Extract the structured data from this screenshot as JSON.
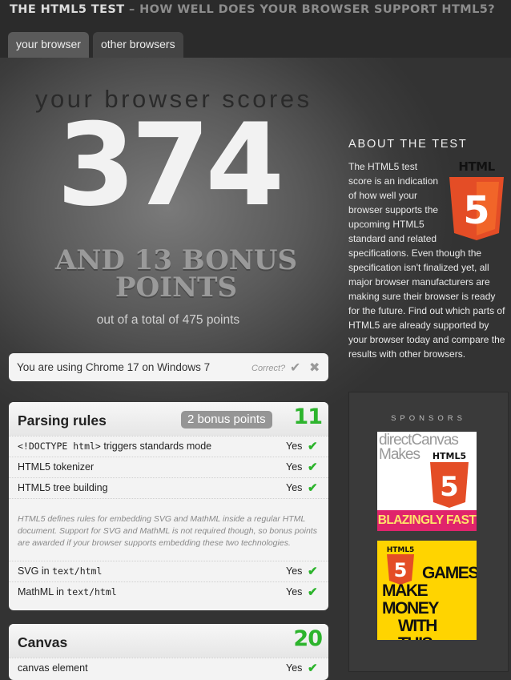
{
  "site": {
    "title": "THE HTML5 TEST",
    "subtitle": "– HOW WELL DOES YOUR BROWSER SUPPORT HTML5?"
  },
  "tabs": [
    {
      "label": "your browser",
      "active": true
    },
    {
      "label": "other browsers",
      "active": false
    }
  ],
  "result": {
    "heading": "your browser scores",
    "score": "374",
    "bonus_line1": "AND 13 BONUS",
    "bonus_line2": "POINTS",
    "total_text": "out of a total of 475 points"
  },
  "detection": {
    "text": "You are using Chrome 17 on Windows 7",
    "correct_label": "Correct?"
  },
  "sections": [
    {
      "title": "Parsing rules",
      "badge": "2 bonus points",
      "score": "11",
      "rows_before": [
        {
          "code": "<!DOCTYPE html>",
          "label": " triggers standards mode",
          "result": "Yes"
        },
        {
          "label": "HTML5 tokenizer",
          "result": "Yes"
        },
        {
          "label": "HTML5 tree building",
          "result": "Yes"
        }
      ],
      "note": "HTML5 defines rules for embedding SVG and MathML inside a regular HTML document. Support for SVG and MathML is not required though, so bonus points are awarded if your browser supports embedding these two technologies.",
      "rows_after": [
        {
          "label": "SVG in ",
          "code": "text/html",
          "result": "Yes"
        },
        {
          "label": "MathML in ",
          "code": "text/html",
          "result": "Yes"
        }
      ]
    },
    {
      "title": "Canvas",
      "score": "20",
      "rows_before": [
        {
          "label": "canvas element",
          "result": "Yes"
        }
      ]
    }
  ],
  "about": {
    "title": "ABOUT THE TEST",
    "logo_text": "HTML",
    "text": "The HTML5 test score is an indication of how well your browser supports the upcoming HTML5 standard and related specifications. Even though the specification isn't finalized yet, all major browser manufacturers are making sure their browser is ready for the future. Find out which parts of HTML5 are already supported by your browser today and compare the results with other browsers."
  },
  "sponsors": {
    "title": "SPONSORS",
    "ad1": {
      "line1": "directCanvas",
      "line2": "Makes",
      "badge": "HTML5",
      "tagline": "BLAZINGLY FAST"
    },
    "ad2": {
      "badge": "HTML5",
      "line1": "GAMES",
      "line2": "MAKE MONEY",
      "line3": "WITH THIS."
    }
  },
  "colors": {
    "accent_green": "#2db42d",
    "html5_orange": "#e44d26",
    "ad_pink": "#e0246c",
    "ad_yellow": "#ffd400"
  }
}
